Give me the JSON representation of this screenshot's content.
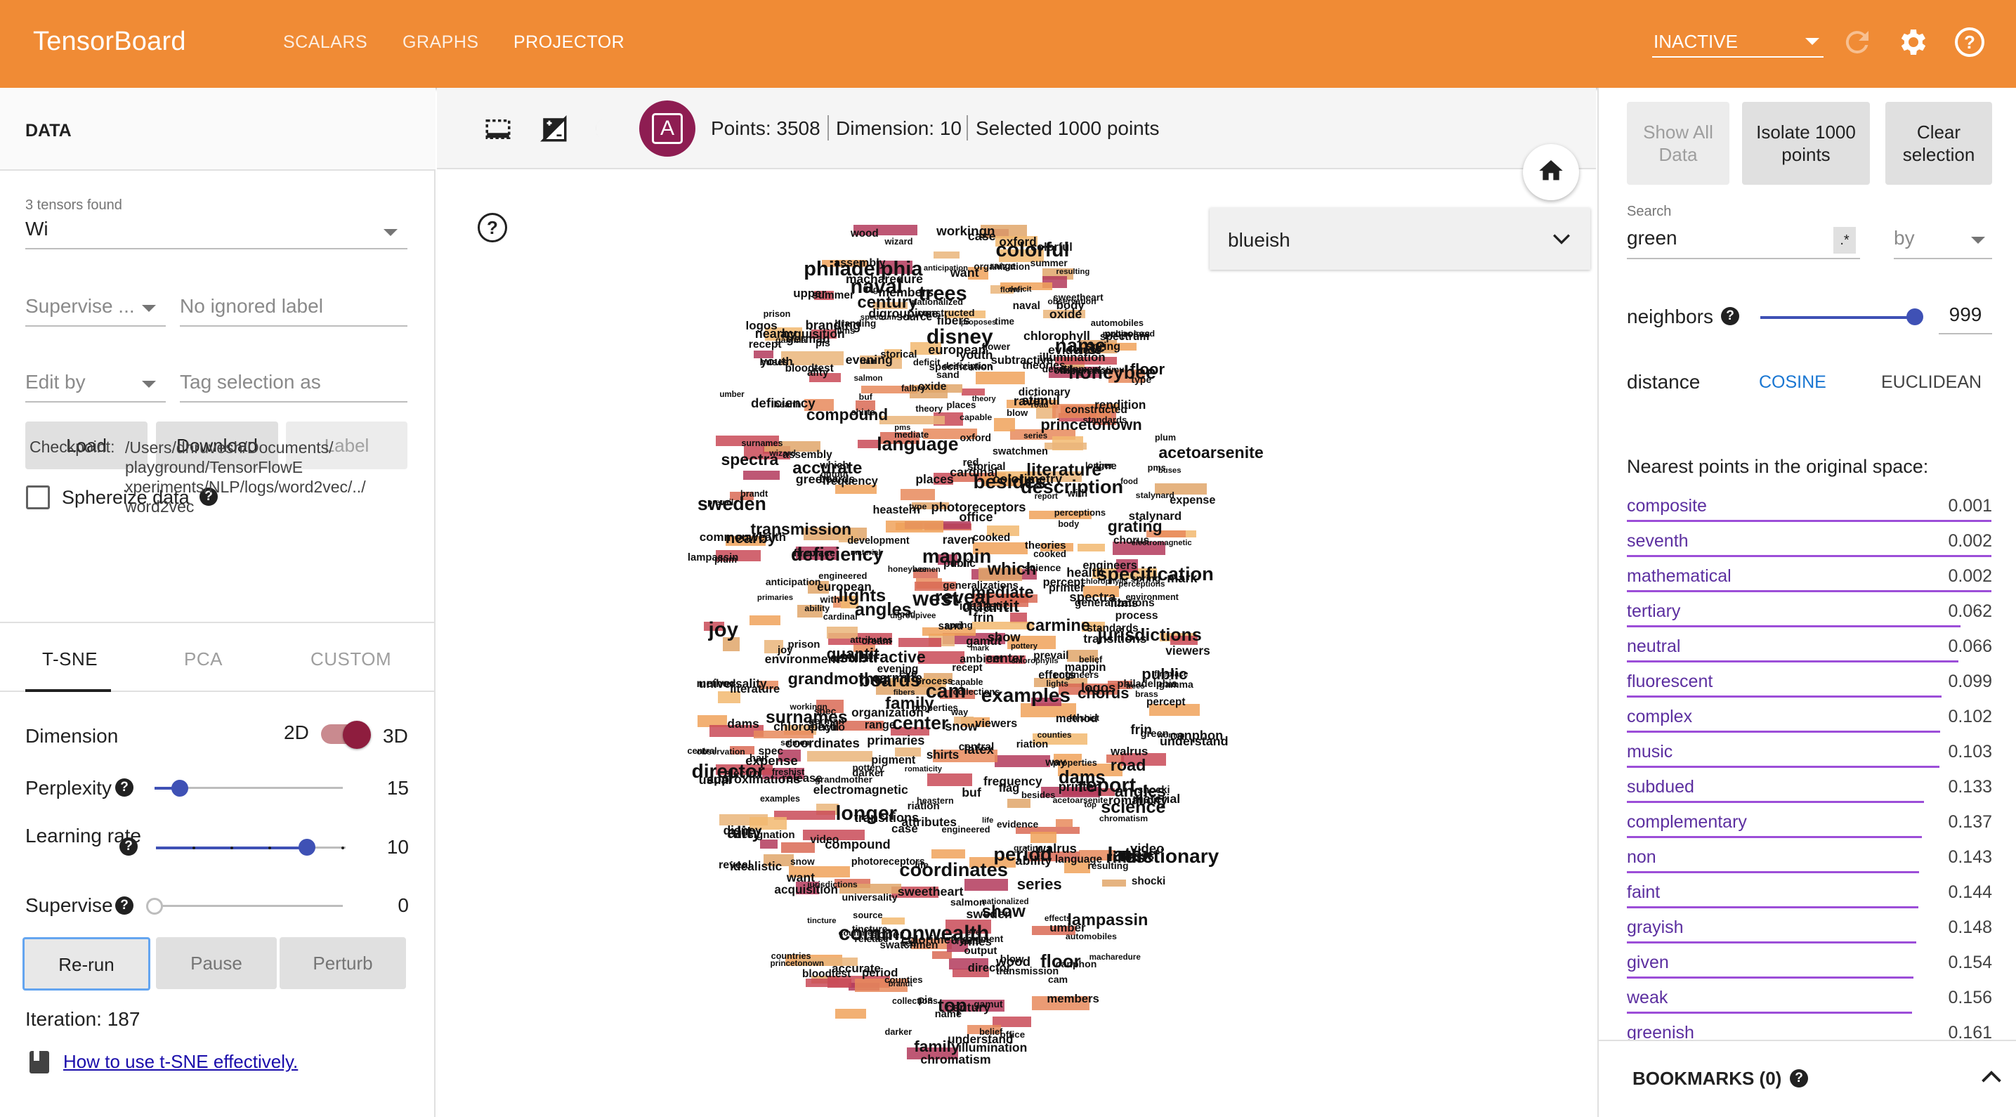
{
  "header": {
    "brand": "TensorBoard",
    "tabs": [
      "SCALARS",
      "GRAPHS",
      "PROJECTOR"
    ],
    "active_tab": "PROJECTOR",
    "run_status": "INACTIVE"
  },
  "left": {
    "section_title": "DATA",
    "tensors_found": "3 tensors found",
    "tensor_value": "Wi",
    "supervise_placeholder": "Supervise ...",
    "ignored_label_placeholder": "No ignored label",
    "edit_by_placeholder": "Edit by",
    "tag_selection_placeholder": "Tag selection as",
    "buttons": {
      "load": "Load",
      "download": "Download",
      "label": "Label"
    },
    "sphereize_label": "Sphereize data",
    "checkpoint_key": "Checkpoint:",
    "checkpoint_value": "/Users/dhruvesh/Documents/ playground/TensorFlowE xperiments/NLP/logs/word2vec/../ word2vec",
    "projection_tabs": [
      "T-SNE",
      "PCA",
      "CUSTOM"
    ],
    "tsne": {
      "dimension_label": "Dimension",
      "dim_2d": "2D",
      "dim_3d": "3D",
      "perplexity_label": "Perplexity",
      "perplexity_value": "15",
      "learning_rate_label": "Learning rate",
      "learning_rate_value": "10",
      "supervise_label": "Supervise",
      "supervise_value": "0",
      "rerun": "Re-run",
      "pause": "Pause",
      "perturb": "Perturb",
      "iteration": "Iteration: 187",
      "howto_link": "How to use t-SNE effectively."
    }
  },
  "toolbar": {
    "avatar_letter": "A",
    "points": "Points: 3508",
    "dimension": "Dimension: 10",
    "selected": "Selected 1000 points"
  },
  "canvas": {
    "color_by": "blueish",
    "help": "?"
  },
  "right": {
    "buttons": {
      "show_all": "Show All Data",
      "isolate": "Isolate 1000 points",
      "clear": "Clear selection"
    },
    "search_label": "Search",
    "search_value": "green",
    "regex_label": ".*",
    "by_placeholder": "by",
    "neighbors_label": "neighbors",
    "neighbors_value": "999",
    "distance_label": "distance",
    "distance_cosine": "COSINE",
    "distance_euclidean": "EUCLIDEAN",
    "nearest_title": "Nearest points in the original space:",
    "nearest": [
      {
        "word": "composite",
        "value": "0.001"
      },
      {
        "word": "seventh",
        "value": "0.002"
      },
      {
        "word": "mathematical",
        "value": "0.002"
      },
      {
        "word": "tertiary",
        "value": "0.062"
      },
      {
        "word": "neutral",
        "value": "0.066"
      },
      {
        "word": "fluorescent",
        "value": "0.099"
      },
      {
        "word": "complex",
        "value": "0.102"
      },
      {
        "word": "music",
        "value": "0.103"
      },
      {
        "word": "subdued",
        "value": "0.133"
      },
      {
        "word": "complementary",
        "value": "0.137"
      },
      {
        "word": "non",
        "value": "0.143"
      },
      {
        "word": "faint",
        "value": "0.144"
      },
      {
        "word": "grayish",
        "value": "0.148"
      },
      {
        "word": "given",
        "value": "0.154"
      },
      {
        "word": "weak",
        "value": "0.156"
      },
      {
        "word": "greenish",
        "value": "0.161"
      }
    ],
    "bookmarks": "BOOKMARKS (0)"
  },
  "colors": {
    "header": "#f08b35",
    "accent": "#8e1d52",
    "neighbor_link": "#5c2fa0",
    "slider": "#3f51b5"
  },
  "scatter_words": [
    "spring",
    "shocki",
    "office",
    "salmon",
    "electro",
    "accurate",
    "wood",
    "cooked",
    "development",
    "commonwealth",
    "observation",
    "transmission",
    "reveal",
    "spectra",
    "besides",
    "photoreceptors",
    "coordinates",
    "european",
    "proposes",
    "cardinal",
    "chromatism",
    "automobiles",
    "swatchmen",
    "disney",
    "illumination",
    "capable",
    "process",
    "stalynard",
    "printer",
    "oxford",
    "pms",
    "blow",
    "riation",
    "oxide",
    "countries",
    "frequency",
    "engineered",
    "assembly",
    "brandt",
    "romaticity",
    "compound",
    "canphon",
    "rifles",
    "standards",
    "viewers",
    "anticipation",
    "evidence",
    "mark",
    "branding",
    "surnames",
    "show",
    "ality",
    "engineers",
    "summer",
    "sand",
    "boards",
    "understand",
    "upper",
    "brass",
    "mediate",
    "trees",
    "quantit",
    "prevail",
    "acetoarsenite",
    "princetonown",
    "youth",
    "series",
    "food",
    "pis",
    "attributes",
    "buses",
    "storical",
    "primaries",
    "red",
    "gamut",
    "colorful",
    "health",
    "nationalized",
    "video",
    "life",
    "properties",
    "organization",
    "films",
    "universality",
    "sweetheart",
    "fibers",
    "honeybee",
    "lampassin",
    "latex",
    "century",
    "nearby",
    "report",
    "green",
    "chlorophylls",
    "darker",
    "logos",
    "electromagnetic",
    "want",
    "evening",
    "lights",
    "carmine",
    "belief",
    "pigment",
    "colorimetry",
    "floor",
    "multicolored",
    "perceptions",
    "family",
    "shirts",
    "usual",
    "top",
    "dictionary",
    "subtractive",
    "raven",
    "chlorophyll",
    "grandmother",
    "umber",
    "ambient",
    "language",
    "pottery",
    "environment",
    "sweden",
    "transitions",
    "constructed",
    "acquisition",
    "eye",
    "gamma",
    "release",
    "dams",
    "places",
    "grating",
    "heastern",
    "literature",
    "theory",
    "digroupivee",
    "resulting",
    "plum",
    "expense",
    "german",
    "flower",
    "counties",
    "designation",
    "workingn",
    "philadelphia",
    "body",
    "wizard",
    "effects",
    "central",
    "rendition",
    "chorus",
    "snow",
    "director",
    "fireplace",
    "ability",
    "frin",
    "spectrum",
    "idealistic",
    "which",
    "time",
    "with",
    "name",
    "approximations",
    "theories",
    "cream",
    "recept",
    "prison",
    "deficiency",
    "hair",
    "tincture",
    "joy",
    "description",
    "science",
    "women",
    "cam",
    "road",
    "percept",
    "stimul",
    "walrus",
    "specification",
    "method",
    "type",
    "west",
    "way",
    "spec",
    "flag",
    "freshist",
    "examples",
    "bloodtest",
    "angles",
    "case",
    "mappin",
    "jurisdictions",
    "buf",
    "range",
    "deficit",
    "falbry",
    "public",
    "generalizations",
    "period",
    "collections",
    "center",
    "longer",
    "output",
    "members",
    "source",
    "naval",
    "macharedure",
    "material"
  ]
}
